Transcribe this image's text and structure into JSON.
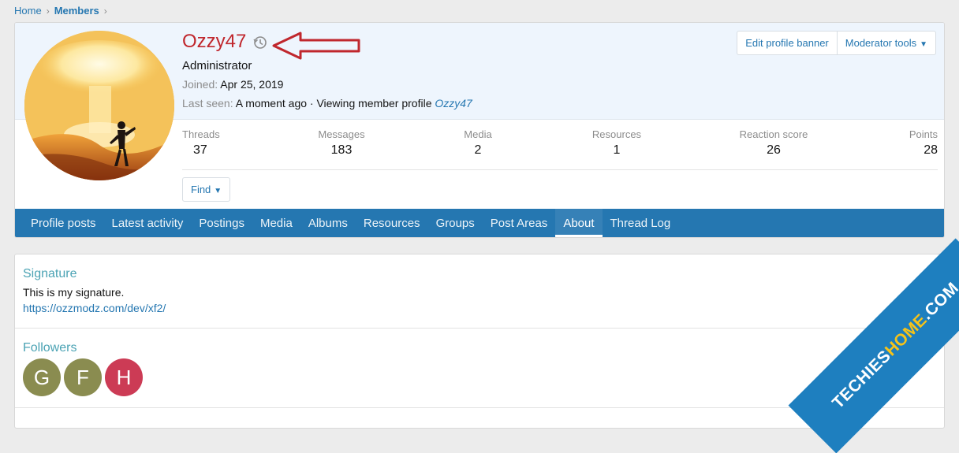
{
  "breadcrumb": {
    "home": "Home",
    "members": "Members"
  },
  "profile": {
    "username": "Ozzy47",
    "role": "Administrator",
    "joined_label": "Joined:",
    "joined_value": "Apr 25, 2019",
    "last_seen_label": "Last seen:",
    "last_seen_value": "A moment ago · Viewing member profile",
    "last_seen_link": "Ozzy47",
    "buttons": {
      "edit_banner": "Edit profile banner",
      "moderator_tools": "Moderator tools"
    },
    "find_label": "Find"
  },
  "stats": [
    {
      "label": "Threads",
      "value": "37"
    },
    {
      "label": "Messages",
      "value": "183"
    },
    {
      "label": "Media",
      "value": "2"
    },
    {
      "label": "Resources",
      "value": "1"
    },
    {
      "label": "Reaction score",
      "value": "26"
    },
    {
      "label": "Points",
      "value": "28"
    }
  ],
  "tabs": [
    {
      "label": "Profile posts"
    },
    {
      "label": "Latest activity"
    },
    {
      "label": "Postings"
    },
    {
      "label": "Media"
    },
    {
      "label": "Albums"
    },
    {
      "label": "Resources"
    },
    {
      "label": "Groups"
    },
    {
      "label": "Post Areas"
    },
    {
      "label": "About",
      "active": true
    },
    {
      "label": "Thread Log"
    }
  ],
  "about": {
    "signature_title": "Signature",
    "signature_text": "This is my signature.",
    "signature_link": "https://ozzmodz.com/dev/xf2/",
    "followers_title": "Followers",
    "followers": [
      {
        "initial": "G",
        "color": "#8a8c50"
      },
      {
        "initial": "F",
        "color": "#8a8c50"
      },
      {
        "initial": "H",
        "color": "#cc3b55"
      }
    ]
  },
  "watermark": {
    "part1": "TECHIES",
    "part2": "HOME",
    "part3": ".COM"
  },
  "colors": {
    "accent": "#2577b1",
    "username": "#c0272d",
    "annotation_arrow": "#c0272d"
  }
}
